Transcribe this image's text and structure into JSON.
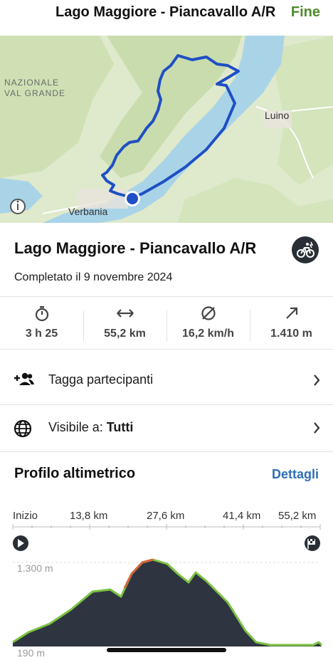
{
  "header": {
    "title": "Lago Maggiore - Piancavallo A/R",
    "done_label": "Fine"
  },
  "map": {
    "labels": {
      "park_line1": "NAZIONALE",
      "park_line2": "VAL GRANDE",
      "luino": "Luino",
      "verbania": "Verbania"
    },
    "icons": [
      "info-icon",
      "start-location-dot-icon"
    ],
    "colors": {
      "route": "#1f4fc4",
      "lake": "#a9d4e8",
      "land": "#dce9c8"
    }
  },
  "activity": {
    "title": "Lago Maggiore - Piancavallo A/R",
    "completed": "Completato il 9 novembre 2024",
    "sport_icon": "cycling-badge-icon"
  },
  "stats": [
    {
      "icon": "stopwatch-icon",
      "value": "3 h 25"
    },
    {
      "icon": "distance-icon",
      "value": "55,2 km"
    },
    {
      "icon": "average-speed-icon",
      "value": "16,2 km/h"
    },
    {
      "icon": "elevation-gain-icon",
      "value": "1.410 m"
    }
  ],
  "rows": {
    "tag": {
      "icon": "add-people-icon",
      "label": "Tagga partecipanti"
    },
    "visibility": {
      "icon": "globe-icon",
      "label": "Visibile a:",
      "value": "Tutti"
    }
  },
  "profile": {
    "title": "Profilo altimetrico",
    "details_link": "Dettagli",
    "x_ticks": [
      "Inizio",
      "13,8 km",
      "27,6 km",
      "41,4 km",
      "55,2 km"
    ],
    "y_max_label": "1.300 m",
    "y_min_label": "190 m",
    "icons": [
      "start-flag-icon",
      "finish-flag-icon"
    ],
    "colors": {
      "fill": "#2e3540",
      "outline": "#7cc243",
      "steep": "#d4653b"
    }
  }
}
